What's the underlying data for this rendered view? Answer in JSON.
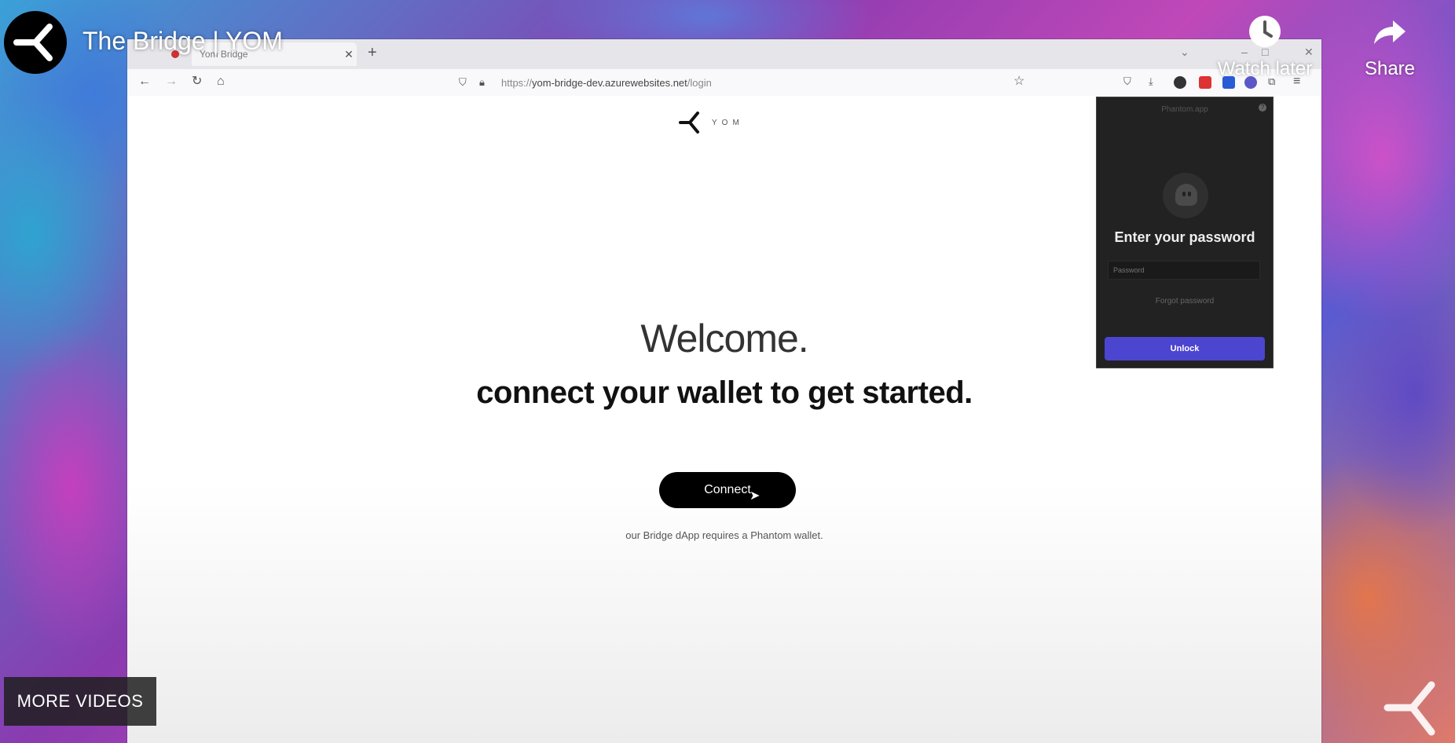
{
  "video": {
    "title": "The Bridge | YOM",
    "watch_later_label": "Watch later",
    "share_label": "Share",
    "more_videos_label": "MORE VIDEOS"
  },
  "browser": {
    "tab_title": "Yom Bridge",
    "url_prefix": "https://",
    "url_host": "yom-bridge-dev.azurewebsites.net",
    "url_path": "/login"
  },
  "page": {
    "logo_text": "YOM",
    "welcome": "Welcome.",
    "subheading": "connect your wallet to get started.",
    "connect_label": "Connect",
    "note": "our Bridge dApp requires a Phantom wallet."
  },
  "phantom": {
    "title": "Phantom.app",
    "heading": "Enter your password",
    "password_placeholder": "Password",
    "forgot_label": "Forgot password",
    "unlock_label": "Unlock",
    "accent": "#4b45d0"
  }
}
